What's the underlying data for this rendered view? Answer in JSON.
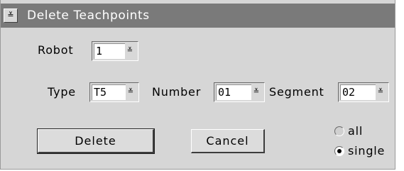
{
  "window": {
    "title": "Delete Teachpoints",
    "menu_glyph": "≚"
  },
  "robot": {
    "label": "Robot",
    "value": "1"
  },
  "type": {
    "label": "Type",
    "value": "T5"
  },
  "number": {
    "label": "Number",
    "value": "01"
  },
  "segment": {
    "label": "Segment",
    "value": "02"
  },
  "dropdown_glyph": "≚",
  "buttons": {
    "delete": "Delete",
    "cancel": "Cancel"
  },
  "mode": {
    "options": [
      {
        "label": "all",
        "selected": false
      },
      {
        "label": "single",
        "selected": true
      }
    ]
  }
}
